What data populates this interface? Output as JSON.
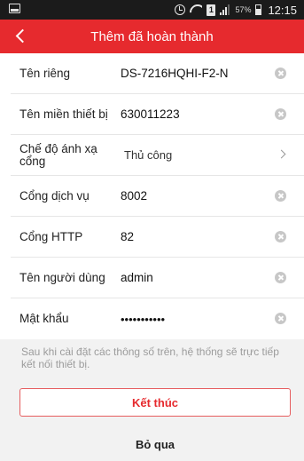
{
  "status_bar": {
    "battery_percent": "57%",
    "time": "12:15",
    "sim_label": "1",
    "icons": [
      "screenshot-icon",
      "alarm-icon",
      "wifi-icon",
      "sim-icon",
      "signal-icon",
      "battery-icon"
    ]
  },
  "header": {
    "title": "Thêm đã hoàn thành",
    "back_icon": "chevron-left-icon",
    "background_color": "#e62a2e"
  },
  "form": {
    "rows": [
      {
        "label": "Tên riêng",
        "value": "DS-7216HQHI-F2-N",
        "action": "clear"
      },
      {
        "label": "Tên miền thiết bị",
        "value": "630011223",
        "action": "clear"
      },
      {
        "label": "Chế độ ánh xạ cổng",
        "value": "Thủ công",
        "action": "select"
      },
      {
        "label": "Cổng dịch vụ",
        "value": "8002",
        "action": "clear"
      },
      {
        "label": "Cổng HTTP",
        "value": "82",
        "action": "clear"
      },
      {
        "label": "Tên người dùng",
        "value": "admin",
        "action": "clear"
      },
      {
        "label": "Mật khẩu",
        "value": "•••••••••••",
        "action": "clear"
      }
    ]
  },
  "hint": "Sau khi cài đặt các thông số trên, hệ thống sẽ trực tiếp kết nối thiết bị.",
  "buttons": {
    "finish": "Kết thúc",
    "skip": "Bỏ qua"
  }
}
